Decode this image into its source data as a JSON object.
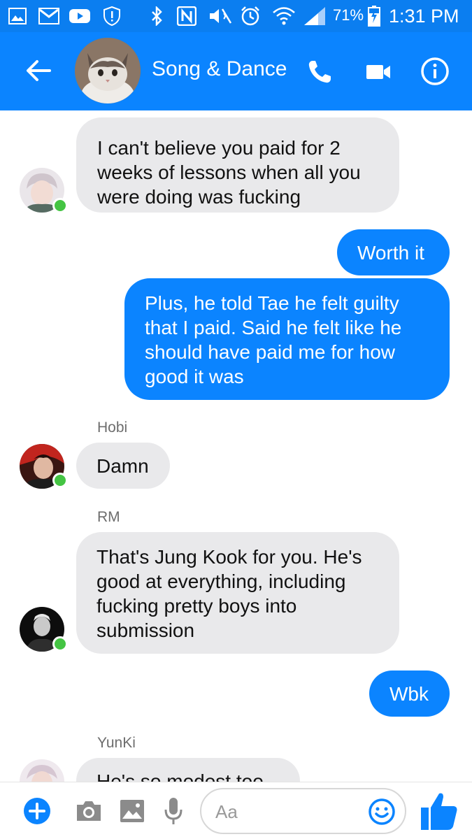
{
  "status_bar": {
    "battery_percent": "71%",
    "time": "1:31 PM",
    "icons": [
      "gallery-icon",
      "gmail-icon",
      "youtube-icon",
      "shield-alert-icon",
      "bluetooth-icon",
      "nfc-icon",
      "mute-icon",
      "alarm-icon",
      "wifi-icon",
      "signal-icon",
      "battery-charging-icon"
    ]
  },
  "header": {
    "title": "Song & Dance",
    "back_icon": "arrow-left-icon",
    "call_icon": "phone-icon",
    "video_icon": "video-camera-icon",
    "info_icon": "info-icon"
  },
  "messages": [
    {
      "from": "incoming",
      "text": "I can't believe you paid for 2\nweeks of lessons when all you\nwere doing was fucking"
    },
    {
      "from": "outgoing",
      "text": "Worth it"
    },
    {
      "from": "outgoing",
      "text": "Plus, he told Tae he felt guilty\nthat I paid. Said he felt like he\nshould have paid me for how\ngood it was"
    },
    {
      "from": "incoming",
      "sender": "Hobi",
      "text": "Damn"
    },
    {
      "from": "incoming",
      "sender": "RM",
      "text": "That's Jung Kook for you. He's\ngood at everything, including\nfucking pretty boys into\nsubmission"
    },
    {
      "from": "outgoing",
      "text": "Wbk"
    },
    {
      "from": "incoming",
      "sender": "YunKi",
      "text": "He's so modest too"
    }
  ],
  "composer": {
    "placeholder": "Aa",
    "icons": [
      "plus-icon",
      "camera-icon",
      "image-icon",
      "microphone-icon",
      "emoji-icon",
      "thumbs-up-icon"
    ]
  },
  "colors": {
    "header_blue": "#0b84ff",
    "outgoing_bubble": "#0b84ff",
    "incoming_bubble": "#e9e9eb",
    "online_dot": "#44c443"
  }
}
